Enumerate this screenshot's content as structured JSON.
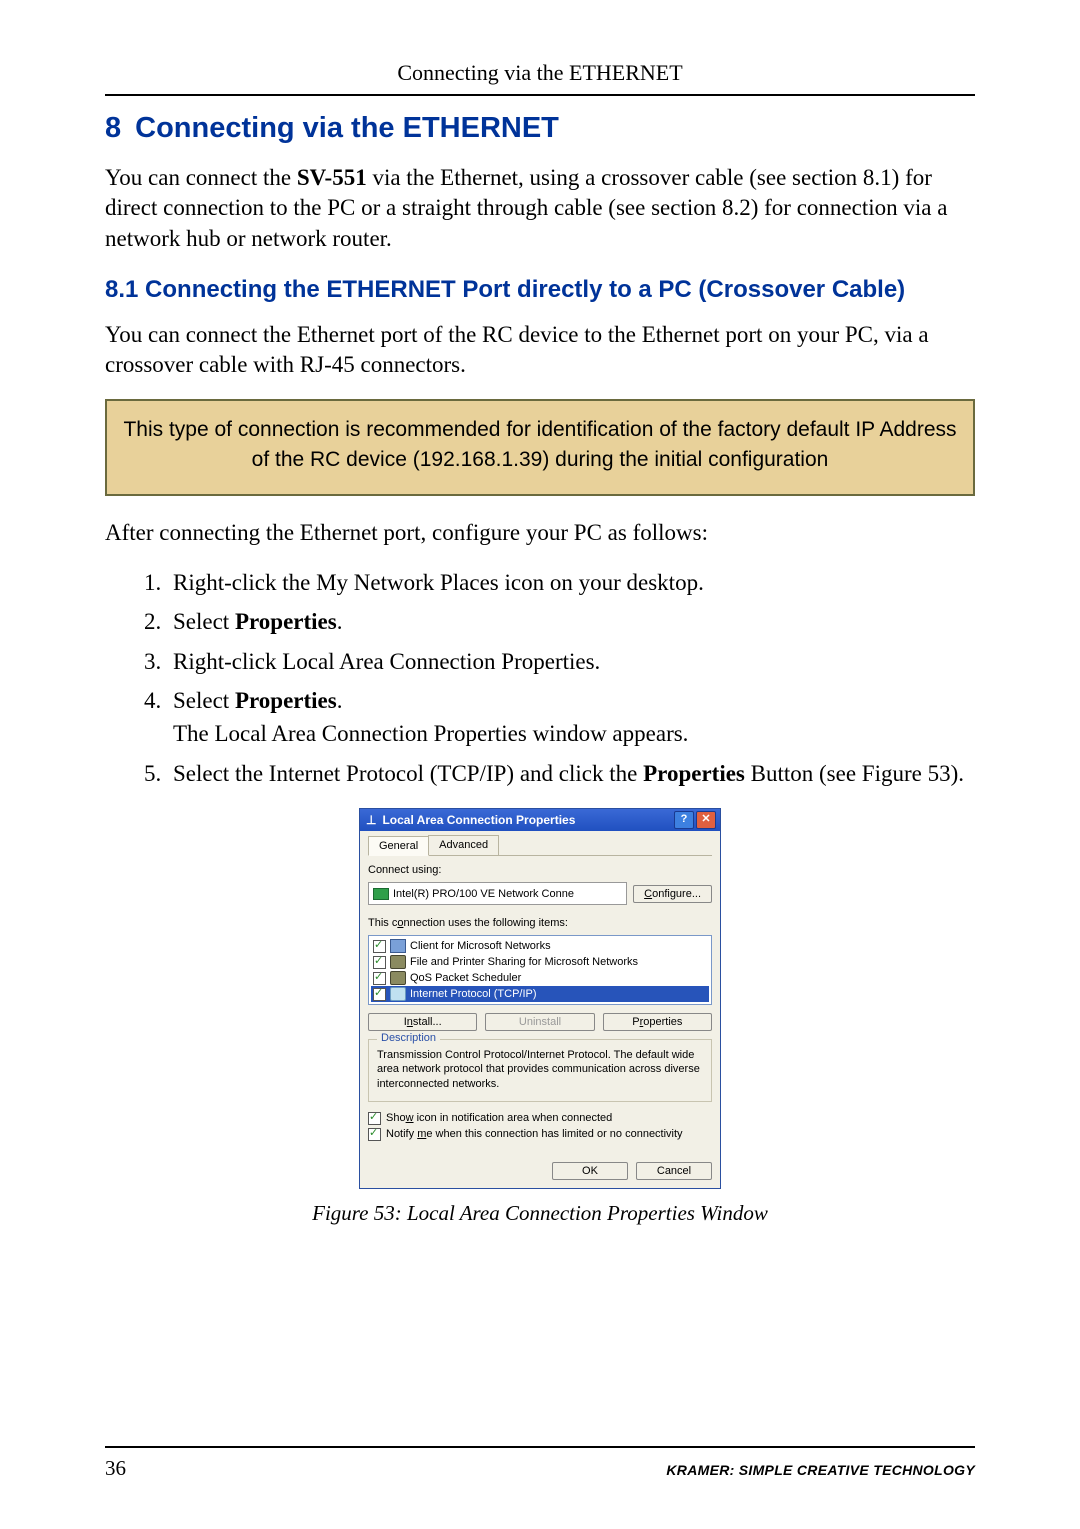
{
  "page": {
    "running_header": "Connecting via the ETHERNET",
    "number": "36",
    "footer_brand": "KRAMER: SIMPLE CREATIVE TECHNOLOGY"
  },
  "section": {
    "number": "8",
    "title": "Connecting via the ETHERNET",
    "intro_a": "You can connect the ",
    "intro_bold": "SV-551",
    "intro_b": " via the Ethernet, using a crossover cable (see section 8.1) for direct connection to the PC or a straight through cable (see section 8.2) for connection via a network hub or network router."
  },
  "subsection": {
    "number": "8.1",
    "title": "Connecting the ETHERNET Port directly to a PC (Crossover Cable)",
    "body": "You can connect the Ethernet port of the RC device to the Ethernet port on your PC, via a crossover cable with RJ-45 connectors.",
    "callout": "This type of connection is recommended for identification of the factory default IP Address of the RC device (192.168.1.39) during the initial configuration",
    "after_callout": "After connecting the Ethernet port, configure your PC as follows:",
    "steps": {
      "s1": "Right-click the My Network Places icon on your desktop.",
      "s2_a": "Select ",
      "s2_bold": "Properties",
      "s2_b": ".",
      "s3": "Right-click Local Area Connection Properties.",
      "s4_a": "Select ",
      "s4_bold": "Properties",
      "s4_b": ".",
      "s4_c": "The Local Area Connection Properties window appears.",
      "s5_a": "Select the Internet Protocol (TCP/IP) and click the ",
      "s5_bold": "Properties",
      "s5_b": " Button (see Figure 53)."
    }
  },
  "dialog": {
    "title": "Local Area Connection Properties",
    "tabs": [
      "General",
      "Advanced"
    ],
    "connect_label": "Connect using:",
    "adapter": "Intel(R) PRO/100 VE Network Conne",
    "configure_btn": "Configure...",
    "uses_label": "This connection uses the following items:",
    "items": [
      {
        "label": "Client for Microsoft Networks",
        "selected": false,
        "icon": "net"
      },
      {
        "label": "File and Printer Sharing for Microsoft Networks",
        "selected": false,
        "icon": "file"
      },
      {
        "label": "QoS Packet Scheduler",
        "selected": false,
        "icon": "qos"
      },
      {
        "label": "Internet Protocol (TCP/IP)",
        "selected": true,
        "icon": "tcp"
      }
    ],
    "install_btn": "Install...",
    "uninstall_btn": "Uninstall",
    "properties_btn": "Properties",
    "desc_legend": "Description",
    "desc_text": "Transmission Control Protocol/Internet Protocol. The default wide area network protocol that provides communication across diverse interconnected networks.",
    "show_icon": "Show icon in notification area when connected",
    "notify": "Notify me when this connection has limited or no connectivity",
    "ok_btn": "OK",
    "cancel_btn": "Cancel"
  },
  "figure_caption": "Figure 53: Local Area Connection Properties Window"
}
